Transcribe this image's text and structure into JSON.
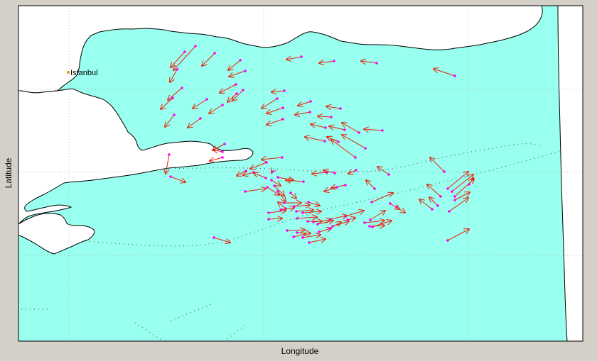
{
  "map": {
    "xlabel": "Longitude",
    "ylabel": "Latitude",
    "colors": {
      "sea": "#99ffee",
      "land": "#ffffff",
      "coast": "#000000",
      "figure_bg": "#d4d0c8",
      "grid": "#aaaaaa",
      "arrow": "#e8200a",
      "point": "#ff00ff",
      "city": "#e0a000",
      "track": "#444444"
    },
    "grid": true,
    "places": [
      {
        "name": "Istanbul"
      }
    ]
  },
  "chart_data": {
    "type": "vector-field",
    "description_units": "screen-estimated relative positions (longitude/latitude axes carry no tick labels)",
    "vectors": [
      [
        275,
        65,
        244,
        99
      ],
      [
        260,
        73,
        240,
        95
      ],
      [
        302,
        75,
        284,
        93
      ],
      [
        249,
        98,
        239,
        116
      ],
      [
        338,
        85,
        321,
        99
      ],
      [
        345,
        100,
        322,
        108
      ],
      [
        332,
        119,
        309,
        131
      ],
      [
        333,
        132,
        320,
        144
      ],
      [
        342,
        127,
        327,
        142
      ],
      [
        256,
        124,
        236,
        141
      ],
      [
        243,
        138,
        226,
        154
      ],
      [
        291,
        140,
        271,
        153
      ],
      [
        313,
        148,
        294,
        160
      ],
      [
        282,
        167,
        264,
        180
      ],
      [
        245,
        162,
        232,
        179
      ],
      [
        424,
        80,
        403,
        84
      ],
      [
        470,
        86,
        449,
        89
      ],
      [
        530,
        89,
        508,
        86
      ],
      [
        640,
        107,
        610,
        97
      ],
      [
        400,
        128,
        382,
        130
      ],
      [
        390,
        139,
        368,
        153
      ],
      [
        398,
        152,
        375,
        160
      ],
      [
        398,
        168,
        375,
        176
      ],
      [
        437,
        143,
        419,
        149
      ],
      [
        436,
        158,
        415,
        162
      ],
      [
        479,
        153,
        459,
        150
      ],
      [
        466,
        165,
        447,
        164
      ],
      [
        458,
        180,
        437,
        175
      ],
      [
        485,
        183,
        463,
        178
      ],
      [
        505,
        187,
        481,
        173
      ],
      [
        538,
        184,
        512,
        182
      ],
      [
        457,
        199,
        429,
        193
      ],
      [
        476,
        200,
        460,
        193
      ],
      [
        514,
        209,
        481,
        190
      ],
      [
        500,
        222,
        466,
        197
      ],
      [
        316,
        203,
        299,
        212
      ],
      [
        313,
        222,
        295,
        227
      ],
      [
        397,
        222,
        368,
        225
      ],
      [
        375,
        229,
        352,
        238
      ],
      [
        313,
        214,
        300,
        211
      ],
      [
        238,
        218,
        233,
        245
      ],
      [
        240,
        249,
        261,
        257
      ],
      [
        346,
        241,
        333,
        248
      ],
      [
        357,
        243,
        342,
        247
      ],
      [
        374,
        251,
        357,
        244
      ],
      [
        460,
        243,
        439,
        245
      ],
      [
        471,
        244,
        455,
        240
      ],
      [
        501,
        240,
        490,
        245
      ],
      [
        547,
        246,
        531,
        235
      ],
      [
        527,
        266,
        515,
        254
      ],
      [
        625,
        242,
        605,
        222
      ],
      [
        630,
        266,
        659,
        242
      ],
      [
        636,
        270,
        666,
        246
      ],
      [
        640,
        277,
        667,
        252
      ],
      [
        660,
        260,
        666,
        251
      ],
      [
        640,
        282,
        661,
        271
      ],
      [
        632,
        298,
        659,
        279
      ],
      [
        620,
        277,
        601,
        260
      ],
      [
        616,
        290,
        604,
        278
      ],
      [
        608,
        295,
        590,
        281
      ],
      [
        630,
        339,
        660,
        323
      ],
      [
        301,
        335,
        324,
        342
      ],
      [
        345,
        270,
        374,
        266
      ],
      [
        376,
        264,
        393,
        275
      ],
      [
        386,
        262,
        400,
        276
      ],
      [
        391,
        270,
        402,
        284
      ],
      [
        409,
        272,
        417,
        280
      ],
      [
        427,
        256,
        402,
        254
      ],
      [
        486,
        261,
        466,
        265
      ],
      [
        474,
        264,
        456,
        270
      ],
      [
        402,
        294,
        391,
        285
      ],
      [
        400,
        286,
        424,
        286
      ],
      [
        395,
        296,
        414,
        293
      ],
      [
        378,
        300,
        402,
        297
      ],
      [
        378,
        309,
        397,
        308
      ],
      [
        417,
        298,
        441,
        296
      ],
      [
        426,
        300,
        452,
        298
      ],
      [
        434,
        285,
        450,
        290
      ],
      [
        414,
        291,
        436,
        289
      ],
      [
        404,
        325,
        429,
        324
      ],
      [
        413,
        334,
        430,
        330
      ],
      [
        418,
        328,
        437,
        329
      ],
      [
        426,
        335,
        451,
        331
      ],
      [
        435,
        342,
        458,
        337
      ],
      [
        449,
        327,
        466,
        322
      ],
      [
        464,
        322,
        480,
        313
      ],
      [
        468,
        319,
        491,
        312
      ],
      [
        486,
        305,
        512,
        297
      ],
      [
        513,
        314,
        541,
        311
      ],
      [
        524,
        320,
        551,
        311
      ],
      [
        521,
        310,
        542,
        297
      ],
      [
        523,
        285,
        553,
        272
      ],
      [
        558,
        292,
        570,
        300
      ],
      [
        549,
        287,
        562,
        295
      ],
      [
        441,
        313,
        465,
        310
      ],
      [
        465,
        309,
        488,
        304
      ],
      [
        489,
        310,
        500,
        307
      ],
      [
        520,
        319,
        541,
        318
      ],
      [
        383,
        242,
        382,
        244
      ],
      [
        391,
        250,
        413,
        254
      ],
      [
        382,
        254,
        395,
        262
      ],
      [
        433,
        312,
        453,
        312
      ],
      [
        447,
        316,
        469,
        311
      ],
      [
        418,
        308,
        446,
        306
      ]
    ]
  }
}
